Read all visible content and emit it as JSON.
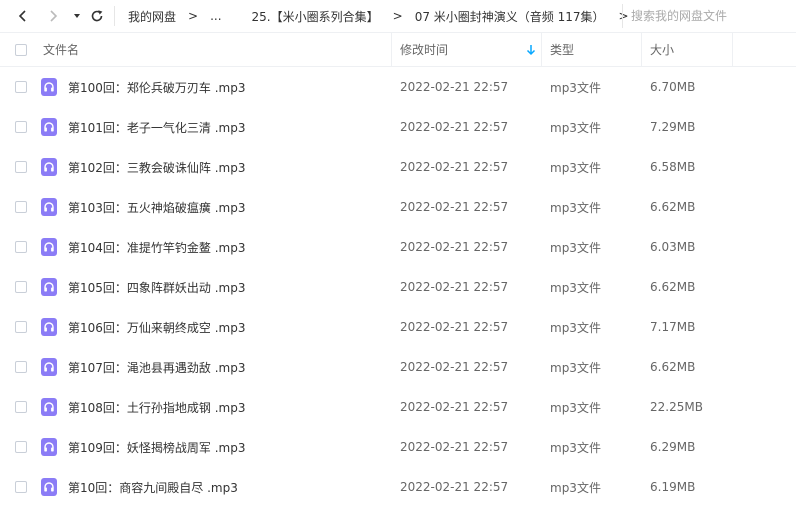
{
  "search": {
    "placeholder": "搜索我的网盘文件"
  },
  "breadcrumb": [
    {
      "label": "我的网盘"
    },
    {
      "label": "..."
    },
    {
      "label": "25.【米小圈系列合集】"
    },
    {
      "label": "07 米小圈封神演义（音频 117集）"
    }
  ],
  "breadcrumb_separator": ">",
  "columns": {
    "name": "文件名",
    "modified": "修改时间",
    "type": "类型",
    "size": "大小"
  },
  "files": [
    {
      "name": "第100回：郑伦兵破万刃车 .mp3",
      "time": "2022-02-21 22:57",
      "type": "mp3文件",
      "size": "6.70MB"
    },
    {
      "name": "第101回：老子一气化三清 .mp3",
      "time": "2022-02-21 22:57",
      "type": "mp3文件",
      "size": "7.29MB"
    },
    {
      "name": "第102回：三教会破诛仙阵 .mp3",
      "time": "2022-02-21 22:57",
      "type": "mp3文件",
      "size": "6.58MB"
    },
    {
      "name": "第103回：五火神焰破瘟癀 .mp3",
      "time": "2022-02-21 22:57",
      "type": "mp3文件",
      "size": "6.62MB"
    },
    {
      "name": "第104回：准提竹竿钓金鳌 .mp3",
      "time": "2022-02-21 22:57",
      "type": "mp3文件",
      "size": "6.03MB"
    },
    {
      "name": "第105回：四象阵群妖出动 .mp3",
      "time": "2022-02-21 22:57",
      "type": "mp3文件",
      "size": "6.62MB"
    },
    {
      "name": "第106回：万仙来朝终成空 .mp3",
      "time": "2022-02-21 22:57",
      "type": "mp3文件",
      "size": "7.17MB"
    },
    {
      "name": "第107回：渑池县再遇劲敌 .mp3",
      "time": "2022-02-21 22:57",
      "type": "mp3文件",
      "size": "6.62MB"
    },
    {
      "name": "第108回：土行孙指地成钢 .mp3",
      "time": "2022-02-21 22:57",
      "type": "mp3文件",
      "size": "22.25MB"
    },
    {
      "name": "第109回：妖怪揭榜战周军 .mp3",
      "time": "2022-02-21 22:57",
      "type": "mp3文件",
      "size": "6.29MB"
    },
    {
      "name": "第10回：商容九间殿自尽 .mp3",
      "time": "2022-02-21 22:57",
      "type": "mp3文件",
      "size": "6.19MB"
    }
  ],
  "colors": {
    "accent": "#06a7ff",
    "file_icon": "#8b7cf6"
  }
}
